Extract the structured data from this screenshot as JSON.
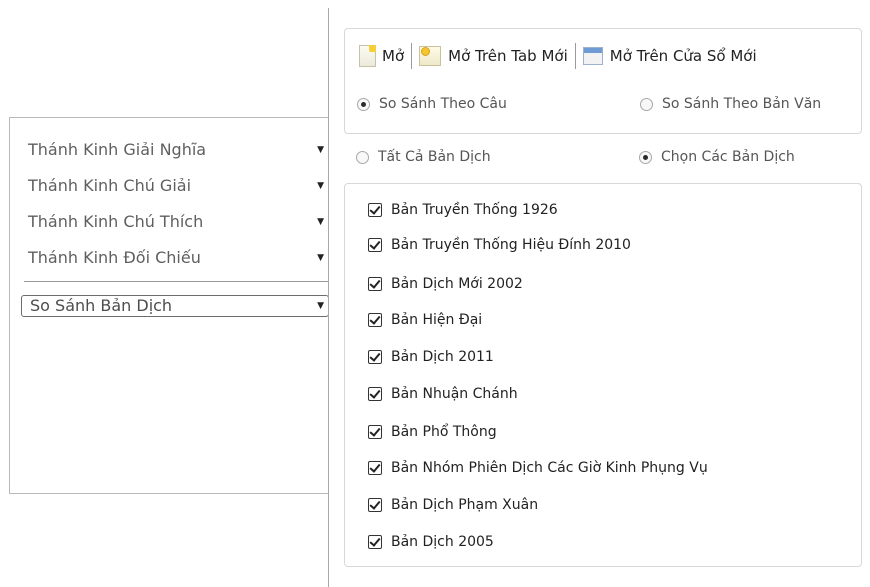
{
  "left_menu": {
    "items": [
      {
        "label": "Thánh Kinh Giải Nghĩa",
        "arrow": "▼"
      },
      {
        "label": "Thánh Kinh Chú Giải",
        "arrow": "▼"
      },
      {
        "label": "Thánh Kinh Chú Thích",
        "arrow": "▼"
      },
      {
        "label": "Thánh Kinh Đối Chiếu",
        "arrow": "▼"
      }
    ],
    "selected": {
      "label": "So Sánh Bản Dịch",
      "arrow": "▼"
    }
  },
  "toolbar": {
    "open_label": "Mở",
    "open_new_tab_label": "Mở Trên Tab Mới",
    "open_new_window_label": "Mở Trên Cửa Sổ Mới"
  },
  "compare_mode": {
    "by_verse": {
      "label": "So Sánh Theo Câu",
      "checked": true
    },
    "by_text": {
      "label": "So Sánh Theo Bản Văn",
      "checked": false
    }
  },
  "version_mode": {
    "all": {
      "label": "Tất Cả Bản Dịch",
      "checked": false
    },
    "select": {
      "label": "Chọn Các Bản Dịch",
      "checked": true
    }
  },
  "versions": [
    {
      "label": "Bản Truyền Thống 1926",
      "checked": true
    },
    {
      "label": "Bản Truyền Thống Hiệu Đính 2010",
      "checked": true
    },
    {
      "label": "Bản Dịch Mới 2002",
      "checked": true
    },
    {
      "label": "Bản Hiện Đại",
      "checked": true
    },
    {
      "label": "Bản Dịch 2011",
      "checked": true
    },
    {
      "label": "Bản Nhuận Chánh",
      "checked": true
    },
    {
      "label": "Bản Phổ Thông",
      "checked": true
    },
    {
      "label": "Bản Nhóm Phiên Dịch Các Giờ Kinh Phụng Vụ",
      "checked": true
    },
    {
      "label": "Bản Dịch Phạm Xuân",
      "checked": true
    },
    {
      "label": "Bản Dịch 2005",
      "checked": true
    }
  ]
}
